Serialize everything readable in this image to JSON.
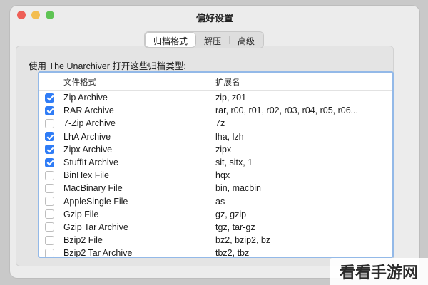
{
  "window": {
    "title": "偏好设置"
  },
  "tabs": [
    {
      "label": "归档格式",
      "active": true
    },
    {
      "label": "解压",
      "active": false
    },
    {
      "label": "高级",
      "active": false
    }
  ],
  "description": "使用 The Unarchiver 打开这些归档类型:",
  "table": {
    "columns": {
      "format": "文件格式",
      "extension": "扩展名"
    },
    "rows": [
      {
        "checked": true,
        "name": "Zip Archive",
        "ext": "zip, z01"
      },
      {
        "checked": true,
        "name": "RAR Archive",
        "ext": "rar, r00, r01, r02, r03, r04, r05, r06..."
      },
      {
        "checked": false,
        "name": "7-Zip Archive",
        "ext": "7z"
      },
      {
        "checked": true,
        "name": "LhA Archive",
        "ext": "lha, lzh"
      },
      {
        "checked": true,
        "name": "Zipx Archive",
        "ext": "zipx"
      },
      {
        "checked": true,
        "name": "StuffIt Archive",
        "ext": "sit, sitx, 1"
      },
      {
        "checked": false,
        "name": "BinHex File",
        "ext": "hqx"
      },
      {
        "checked": false,
        "name": "MacBinary File",
        "ext": "bin, macbin"
      },
      {
        "checked": false,
        "name": "AppleSingle File",
        "ext": "as"
      },
      {
        "checked": false,
        "name": "Gzip File",
        "ext": "gz, gzip"
      },
      {
        "checked": false,
        "name": "Gzip Tar Archive",
        "ext": "tgz, tar-gz"
      },
      {
        "checked": false,
        "name": "Bzip2 File",
        "ext": "bz2, bzip2, bz"
      },
      {
        "checked": false,
        "name": "Bzip2 Tar Archive",
        "ext": "tbz2, tbz"
      }
    ]
  },
  "watermark": {
    "text": "看看手游网"
  },
  "colors": {
    "accent": "#2f7cf6",
    "focus_ring": "#93b9e8"
  }
}
